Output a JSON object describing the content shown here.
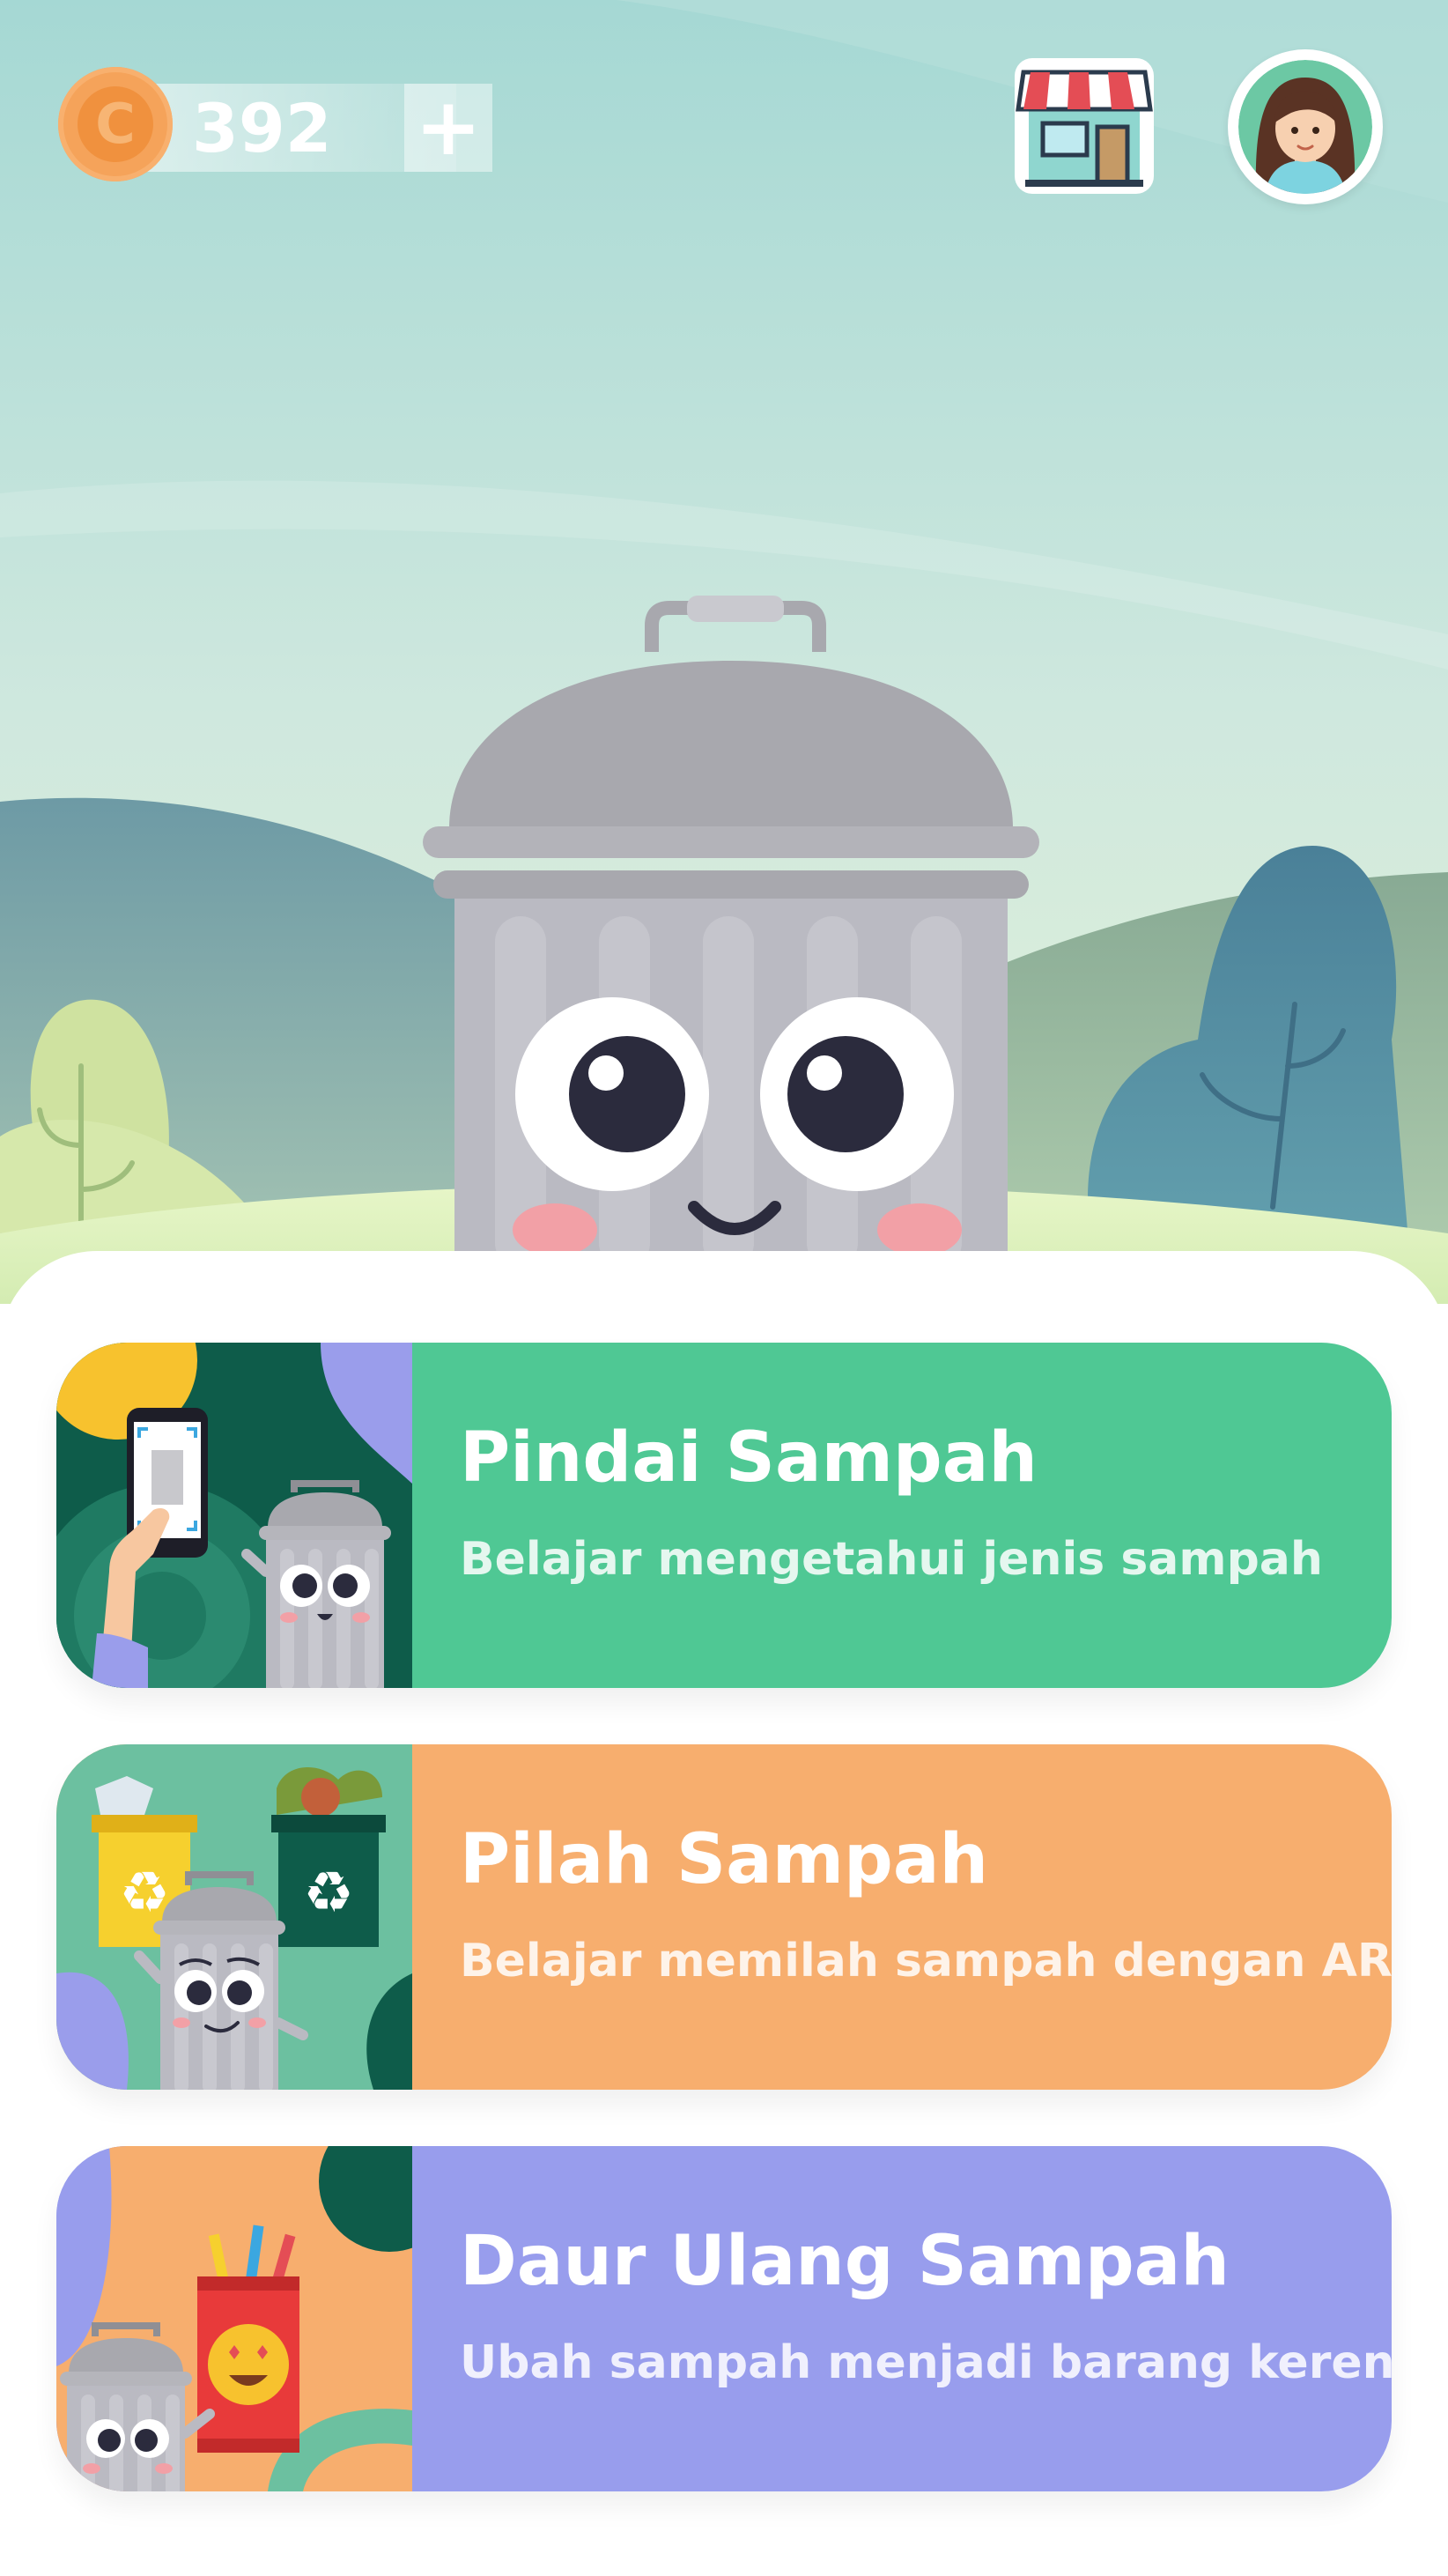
{
  "header": {
    "coins": "392",
    "add_coins_label": "+",
    "coin_symbol": "C",
    "shop_icon": "shop-icon",
    "avatar_icon": "profile-avatar-icon"
  },
  "hero": {
    "mascot_icon": "trash-can-mascot"
  },
  "menu": [
    {
      "title": "Pindai Sampah",
      "description": "Belajar mengetahui jenis sampah",
      "color": "#4fc894",
      "icon": "scan-phone-illustration"
    },
    {
      "title": "Pilah Sampah",
      "description": "Belajar memilah sampah dengan AR",
      "color": "#f7ae6e",
      "icon": "sorting-bins-illustration"
    },
    {
      "title": "Daur Ulang Sampah",
      "description": "Ubah sampah menjadi barang keren!",
      "color": "#989ded",
      "icon": "recycle-can-illustration"
    }
  ]
}
